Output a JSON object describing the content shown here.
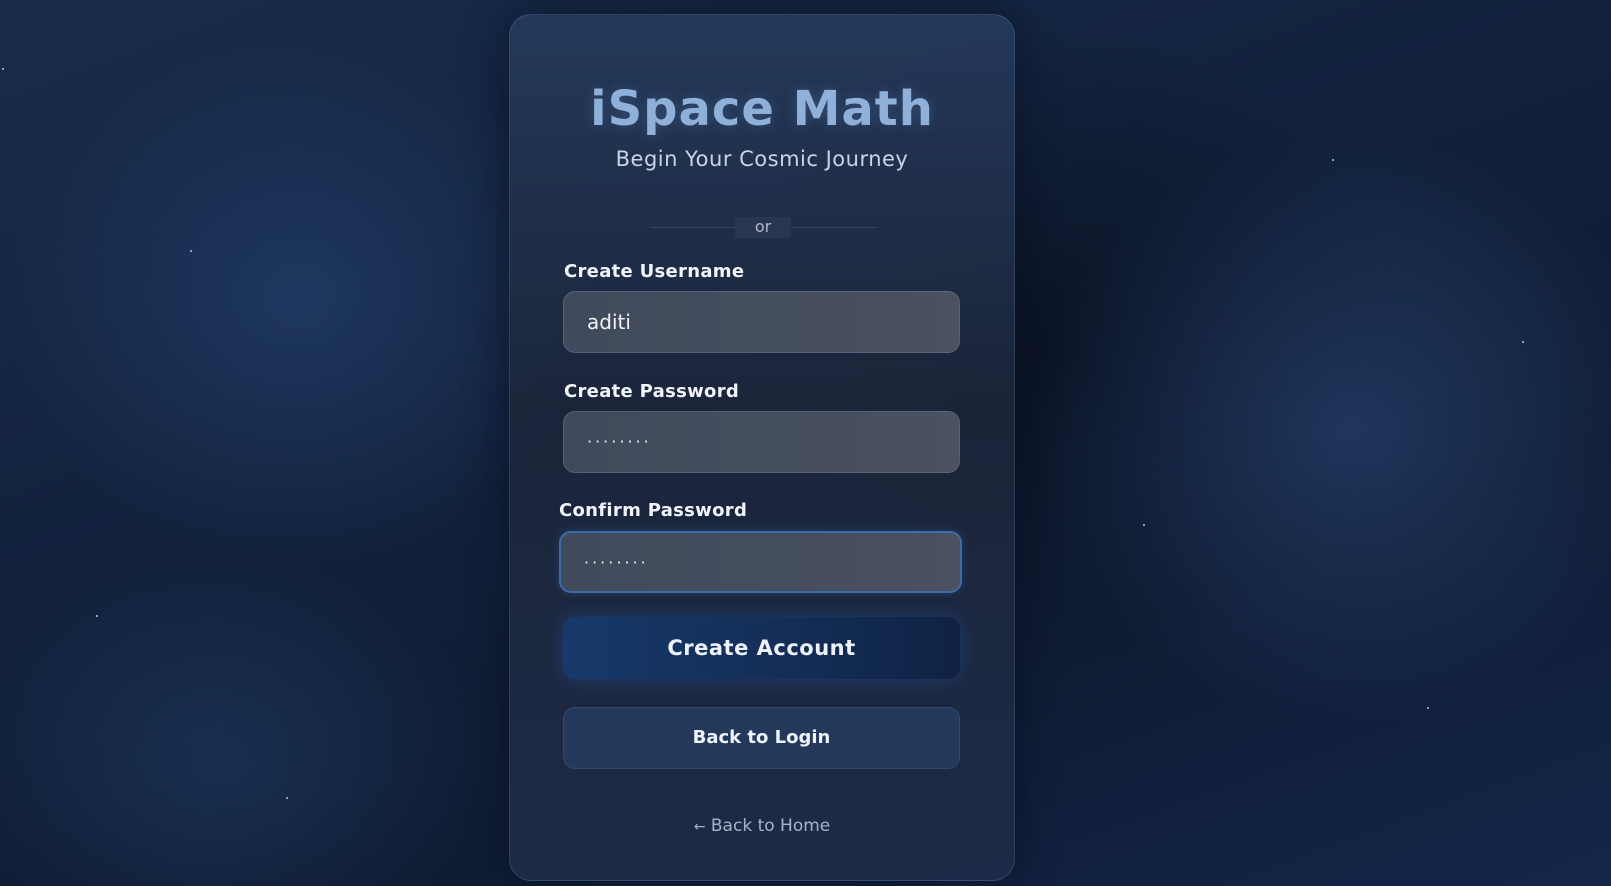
{
  "header": {
    "title": "iSpace Math",
    "subtitle": "Begin Your Cosmic Journey"
  },
  "divider": {
    "label": "or"
  },
  "form": {
    "username": {
      "label": "Create Username",
      "value": "aditi"
    },
    "password": {
      "label": "Create Password",
      "value": "········"
    },
    "confirm_password": {
      "label": "Confirm Password",
      "value": "········"
    }
  },
  "buttons": {
    "create_account": "Create Account",
    "back_to_login": "Back to Login"
  },
  "footer": {
    "arrow": "←",
    "home_link": "Back to Home"
  },
  "colors": {
    "title": "#8fb0d8",
    "primary_button": "#17396b",
    "focus_border": "#3e6aa8"
  }
}
